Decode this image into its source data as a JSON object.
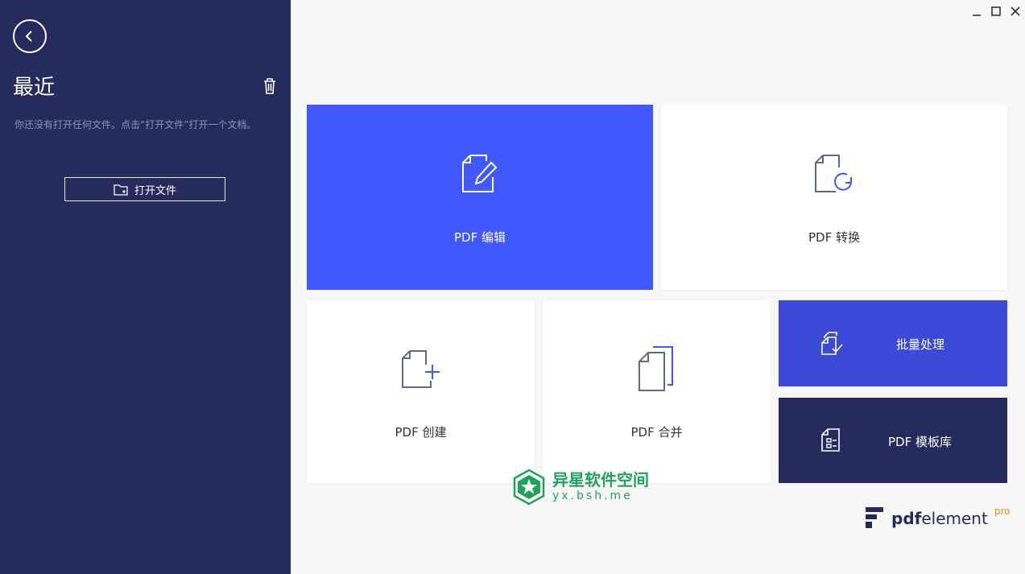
{
  "sidebar": {
    "title": "最近",
    "empty_hint": "你还没有打开任何文件。点击“打开文件”打开一个文档。",
    "open_file_label": "打开文件"
  },
  "tiles": {
    "edit": "PDF 编辑",
    "convert": "PDF 转换",
    "create": "PDF 创建",
    "merge": "PDF 合并",
    "batch": "批量处理",
    "template": "PDF 模板库"
  },
  "watermark": {
    "title": "异星软件空间",
    "url": "yx.bsh.me"
  },
  "brand": {
    "name_bold": "pdf",
    "name_rest": "element",
    "edition": "pro"
  },
  "colors": {
    "sidebar_bg": "#262b5e",
    "accent_blue": "#4258ff",
    "batch_blue": "#3a4ad6",
    "watermark_green": "#1fa25a",
    "pro_orange": "#f08a1c"
  },
  "icons": {
    "back": "back-arrow-icon",
    "trash": "trash-icon",
    "folder": "folder-icon",
    "edit": "pdf-edit-icon",
    "convert": "pdf-convert-icon",
    "create": "pdf-create-icon",
    "merge": "pdf-merge-icon",
    "batch": "batch-process-icon",
    "template": "template-icon"
  }
}
